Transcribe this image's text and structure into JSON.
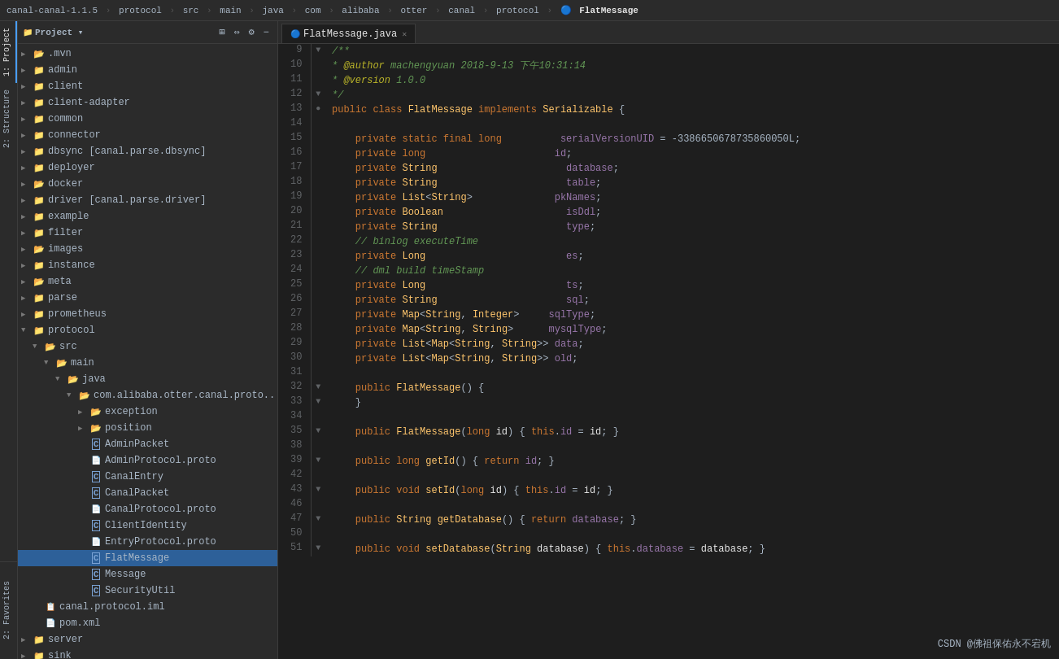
{
  "breadcrumb": {
    "items": [
      {
        "label": "canal-canal-1.1.5",
        "sep": true
      },
      {
        "label": "protocol",
        "sep": true
      },
      {
        "label": "src",
        "sep": true
      },
      {
        "label": "main",
        "sep": true
      },
      {
        "label": "java",
        "sep": true
      },
      {
        "label": "com",
        "sep": true
      },
      {
        "label": "alibaba",
        "sep": true
      },
      {
        "label": "otter",
        "sep": true
      },
      {
        "label": "canal",
        "sep": true
      },
      {
        "label": "protocol",
        "sep": true
      },
      {
        "label": "FlatMessage",
        "sep": false,
        "isLast": true
      }
    ]
  },
  "panel": {
    "title": "Project",
    "icons": [
      "globe-icon",
      "settings-icon",
      "minus-icon"
    ]
  },
  "tabs": {
    "active": "FlatMessage.java",
    "items": [
      {
        "label": "FlatMessage.java",
        "icon": "java-icon"
      }
    ]
  },
  "vtabs": [
    {
      "label": "1: Project",
      "active": true
    },
    {
      "label": "2: Structure"
    },
    {
      "label": "2: Favorites"
    }
  ],
  "tree": [
    {
      "indent": 0,
      "arrow": "▶",
      "icon": "folder",
      "label": ".mvn"
    },
    {
      "indent": 0,
      "arrow": "▶",
      "icon": "folder-blue",
      "label": "admin"
    },
    {
      "indent": 0,
      "arrow": "▶",
      "icon": "folder-blue",
      "label": "client"
    },
    {
      "indent": 0,
      "arrow": "▶",
      "icon": "folder-blue",
      "label": "client-adapter"
    },
    {
      "indent": 0,
      "arrow": "▶",
      "icon": "folder-blue",
      "label": "common"
    },
    {
      "indent": 0,
      "arrow": "▶",
      "icon": "folder-blue",
      "label": "connector"
    },
    {
      "indent": 0,
      "arrow": "▶",
      "icon": "folder-blue",
      "label": "dbsync [canal.parse.dbsync]"
    },
    {
      "indent": 0,
      "arrow": "▶",
      "icon": "folder-blue",
      "label": "deployer"
    },
    {
      "indent": 0,
      "arrow": "▶",
      "icon": "folder",
      "label": "docker"
    },
    {
      "indent": 0,
      "arrow": "▶",
      "icon": "folder-blue",
      "label": "driver [canal.parse.driver]"
    },
    {
      "indent": 0,
      "arrow": "▶",
      "icon": "folder-blue",
      "label": "example"
    },
    {
      "indent": 0,
      "arrow": "▶",
      "icon": "folder-blue",
      "label": "filter"
    },
    {
      "indent": 0,
      "arrow": "▶",
      "icon": "folder",
      "label": "images"
    },
    {
      "indent": 0,
      "arrow": "▶",
      "icon": "folder-blue",
      "label": "instance"
    },
    {
      "indent": 0,
      "arrow": "▶",
      "icon": "folder",
      "label": "meta"
    },
    {
      "indent": 0,
      "arrow": "▶",
      "icon": "folder-blue",
      "label": "parse"
    },
    {
      "indent": 0,
      "arrow": "▶",
      "icon": "folder-blue",
      "label": "prometheus"
    },
    {
      "indent": 0,
      "arrow": "▼",
      "icon": "folder-blue",
      "label": "protocol",
      "open": true
    },
    {
      "indent": 1,
      "arrow": "▼",
      "icon": "folder",
      "label": "src",
      "open": true
    },
    {
      "indent": 2,
      "arrow": "▼",
      "icon": "folder",
      "label": "main",
      "open": true
    },
    {
      "indent": 3,
      "arrow": "▼",
      "icon": "folder",
      "label": "java",
      "open": true
    },
    {
      "indent": 4,
      "arrow": "▼",
      "icon": "folder",
      "label": "com.alibaba.otter.canal.proto...",
      "open": true
    },
    {
      "indent": 5,
      "arrow": "▶",
      "icon": "folder",
      "label": "exception"
    },
    {
      "indent": 5,
      "arrow": "▶",
      "icon": "folder",
      "label": "position"
    },
    {
      "indent": 5,
      "arrow": "",
      "icon": "java",
      "label": "AdminPacket"
    },
    {
      "indent": 5,
      "arrow": "",
      "icon": "proto",
      "label": "AdminProtocol.proto"
    },
    {
      "indent": 5,
      "arrow": "",
      "icon": "java",
      "label": "CanalEntry"
    },
    {
      "indent": 5,
      "arrow": "",
      "icon": "java",
      "label": "CanalPacket"
    },
    {
      "indent": 5,
      "arrow": "",
      "icon": "proto",
      "label": "CanalProtocol.proto"
    },
    {
      "indent": 5,
      "arrow": "",
      "icon": "java",
      "label": "ClientIdentity"
    },
    {
      "indent": 5,
      "arrow": "",
      "icon": "proto",
      "label": "EntryProtocol.proto"
    },
    {
      "indent": 5,
      "arrow": "",
      "icon": "java",
      "label": "FlatMessage",
      "selected": true
    },
    {
      "indent": 5,
      "arrow": "",
      "icon": "java",
      "label": "Message"
    },
    {
      "indent": 5,
      "arrow": "",
      "icon": "java",
      "label": "SecurityUtil"
    },
    {
      "indent": 0,
      "arrow": "",
      "icon": "iml",
      "label": "canal.protocol.iml",
      "indentClass": "indent-0",
      "extraPad": "14px"
    },
    {
      "indent": 0,
      "arrow": "",
      "icon": "xml",
      "label": "pom.xml"
    },
    {
      "indent": 0,
      "arrow": "▶",
      "icon": "folder-blue",
      "label": "server"
    },
    {
      "indent": 0,
      "arrow": "▶",
      "icon": "folder-blue",
      "label": "sink"
    }
  ],
  "code": {
    "lines": [
      {
        "num": 9,
        "fold": "▼",
        "content": "<cmt>/**</cmt>"
      },
      {
        "num": 10,
        "fold": "",
        "content": " * <ann>@author</ann> <cmt>machengyuan 2018-9-13 下午10:31:14</cmt>"
      },
      {
        "num": 11,
        "fold": "",
        "content": " * <ann>@version</ann> <cmt>1.0.0</cmt>"
      },
      {
        "num": 12,
        "fold": "▼",
        "content": " <cmt>*/</cmt>"
      },
      {
        "num": 13,
        "fold": "●",
        "content": "<kw2>public</kw2> <kw>class</kw> <cls>FlatMessage</cls> <kw>implements</kw> <cls>Serializable</cls> {"
      },
      {
        "num": 14,
        "fold": "",
        "content": ""
      },
      {
        "num": 15,
        "fold": "",
        "content": "    <kw2>private</kw2> <kw2>static</kw2> <kw2>final</kw2> <kw>long</kw>          <fld>serialVersionUID</fld> = -3386650678735860050L;"
      },
      {
        "num": 16,
        "fold": "",
        "content": "    <kw2>private</kw2> <kw>long</kw>                          <fld>id</fld>;"
      },
      {
        "num": 17,
        "fold": "",
        "content": "    <kw2>private</kw2> <cls>String</cls>                        <fld>database</fld>;"
      },
      {
        "num": 18,
        "fold": "",
        "content": "    <kw2>private</kw2> <cls>String</cls>                        <fld>table</fld>;"
      },
      {
        "num": 19,
        "fold": "",
        "content": "    <kw2>private</kw2> <cls>List</cls>&lt;<cls>String</cls>&gt;              <fld>pkNames</fld>;"
      },
      {
        "num": 20,
        "fold": "",
        "content": "    <kw2>private</kw2> <cls>Boolean</cls>                       <fld>isDdl</fld>;"
      },
      {
        "num": 21,
        "fold": "",
        "content": "    <kw2>private</kw2> <cls>String</cls>                        <fld>type</fld>;"
      },
      {
        "num": 22,
        "fold": "",
        "content": "    <cmt>// binlog executeTime</cmt>"
      },
      {
        "num": 23,
        "fold": "",
        "content": "    <kw2>private</kw2> <cls>Long</cls>                          <fld>es</fld>;"
      },
      {
        "num": 24,
        "fold": "",
        "content": "    <cmt>// dml build timeStamp</cmt>"
      },
      {
        "num": 25,
        "fold": "",
        "content": "    <kw2>private</kw2> <cls>Long</cls>                          <fld>ts</fld>;"
      },
      {
        "num": 26,
        "fold": "",
        "content": "    <kw2>private</kw2> <cls>String</cls>                        <fld>sql</fld>;"
      },
      {
        "num": 27,
        "fold": "",
        "content": "    <kw2>private</kw2> <cls>Map</cls>&lt;<cls>String</cls>, <cls>Integer</cls>&gt;     <fld>sqlType</fld>;"
      },
      {
        "num": 28,
        "fold": "",
        "content": "    <kw2>private</kw2> <cls>Map</cls>&lt;<cls>String</cls>, <cls>String</cls>&gt;      <fld>mysqlType</fld>;"
      },
      {
        "num": 29,
        "fold": "",
        "content": "    <kw2>private</kw2> <cls>List</cls>&lt;<cls>Map</cls>&lt;<cls>String</cls>, <cls>String</cls>&gt;&gt; <fld>data</fld>;"
      },
      {
        "num": 30,
        "fold": "",
        "content": "    <kw2>private</kw2> <cls>List</cls>&lt;<cls>Map</cls>&lt;<cls>String</cls>, <cls>String</cls>&gt;&gt; <fld>old</fld>;"
      },
      {
        "num": 31,
        "fold": "",
        "content": ""
      },
      {
        "num": 32,
        "fold": "▼",
        "content": "    <kw2>public</kw2> <cls>FlatMessage</cls>() {"
      },
      {
        "num": 33,
        "fold": "▼",
        "content": "    }"
      },
      {
        "num": 34,
        "fold": "",
        "content": ""
      },
      {
        "num": 35,
        "fold": "▼",
        "content": "    <kw2>public</kw2> <cls>FlatMessage</cls>(<kw>long</kw> <param>id</param>) { <kw2>this</kw2>.<fld>id</fld> = <param>id</param>; }"
      },
      {
        "num": 38,
        "fold": "",
        "content": ""
      },
      {
        "num": 39,
        "fold": "▼",
        "content": "    <kw2>public</kw2> <kw>long</kw> <mtd>getId</mtd>() { <kw>return</kw> <fld>id</fld>; }"
      },
      {
        "num": 42,
        "fold": "",
        "content": ""
      },
      {
        "num": 43,
        "fold": "▼",
        "content": "    <kw2>public</kw2> <kw>void</kw> <mtd>setId</mtd>(<kw>long</kw> <param>id</param>) { <kw2>this</kw2>.<fld>id</fld> = <param>id</param>; }"
      },
      {
        "num": 46,
        "fold": "",
        "content": ""
      },
      {
        "num": 47,
        "fold": "▼",
        "content": "    <kw2>public</kw2> <cls>String</cls> <mtd>getDatabase</mtd>() { <kw>return</kw> <fld>database</fld>; }"
      },
      {
        "num": 50,
        "fold": "",
        "content": ""
      },
      {
        "num": 51,
        "fold": "▼",
        "content": "    <kw2>public</kw2> <kw>void</kw> <mtd>setDatabase</mtd>(<cls>String</cls> <param>database</param>) { <kw2>this</kw2>.<fld>database</fld> = <param>database</param>; }"
      }
    ]
  },
  "watermark": "CSDN @佛祖保佑永不宕机"
}
